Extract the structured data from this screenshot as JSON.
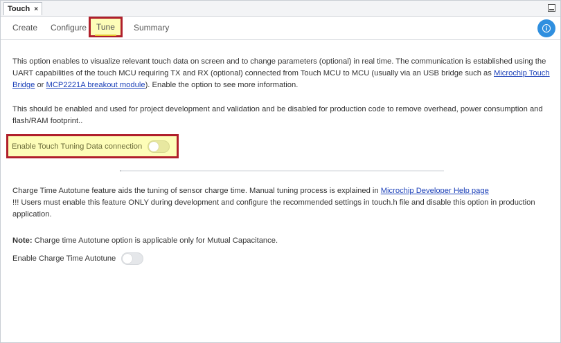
{
  "titlebar": {
    "doc_tab_label": "Touch",
    "close_glyph": "×"
  },
  "tabs": [
    {
      "label": "Create",
      "active": false
    },
    {
      "label": "Configure",
      "active": false
    },
    {
      "label": "Tune",
      "active": true
    },
    {
      "label": "Summary",
      "active": false
    }
  ],
  "info_button": {
    "glyph": "i",
    "icon": "info-icon"
  },
  "tune": {
    "intro_1": "This option enables to visualize relevant touch data on screen and to change parameters (optional) in real time. The communication is established using the UART capabilities of the touch MCU requiring TX and RX (optional) connected from Touch MCU to MCU (usually via an USB bridge such as ",
    "link_bridge": "Microchip Touch Bridge",
    "intro_or": " or ",
    "link_mcp": "MCP2221A breakout module",
    "intro_2": "). Enable the option to see more information.",
    "dev_note": "This should be enabled and used for project development and validation and be disabled for production code to remove overhead, power consumption and flash/RAM footprint..",
    "tuning_toggle": {
      "label": "Enable Touch Tuning Data connection",
      "enabled": false
    },
    "autotune_text": "Charge Time Autotune feature aids the tuning of sensor charge time. Manual tuning process is explained in ",
    "link_dev_help": "Microchip Developer Help page",
    "autotune_warning": "!!! Users must enable this feature ONLY during development and configure the recommended settings in touch.h file and disable this option in production application.",
    "note_label": "Note:",
    "note_text": " Charge time Autotune option is applicable only for Mutual Capacitance.",
    "autotune_toggle": {
      "label": "Enable Charge Time Autotune",
      "enabled": false
    }
  },
  "colors": {
    "highlight_fill": "#fdfdb8",
    "highlight_border": "#b01f2b",
    "accent_blue": "#2f8fdf",
    "link": "#1a3fb8"
  }
}
